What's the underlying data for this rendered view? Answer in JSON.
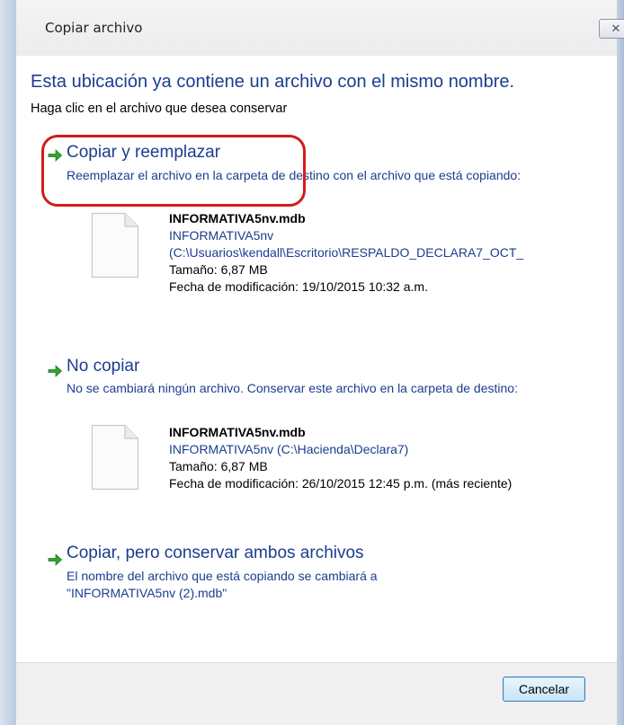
{
  "window": {
    "title": "Copiar archivo",
    "close_glyph": "✕"
  },
  "dialog": {
    "heading": "Esta ubicación ya contiene un archivo con el mismo nombre.",
    "instruction": "Haga clic en el archivo que desea conservar"
  },
  "options": [
    {
      "title": "Copiar y reemplazar",
      "description": "Reemplazar el archivo en la carpeta de destino con el archivo que está copiando:",
      "file": {
        "name": "INFORMATIVA5nv.mdb",
        "path_lines": [
          "INFORMATIVA5nv",
          "(C:\\Usuarios\\kendall\\Escritorio\\RESPALDO_DECLARA7_OCT_"
        ],
        "size": "Tamaño: 6,87 MB",
        "modified": "Fecha de modificación: 19/10/2015 10:32 a.m."
      }
    },
    {
      "title": "No copiar",
      "description": "No se cambiará ningún archivo. Conservar este archivo en la carpeta de destino:",
      "file": {
        "name": "INFORMATIVA5nv.mdb",
        "path_lines": [
          "INFORMATIVA5nv (C:\\Hacienda\\Declara7)"
        ],
        "size": "Tamaño: 6,87 MB",
        "modified": "Fecha de modificación: 26/10/2015 12:45 p.m. (más reciente)"
      }
    },
    {
      "title": "Copiar, pero conservar ambos archivos",
      "description_lines": [
        "El nombre del archivo que está copiando se cambiará a",
        "\"INFORMATIVA5nv (2).mdb\""
      ]
    }
  ],
  "footer": {
    "cancel_label": "Cancelar"
  },
  "icons": {
    "arrow": "green-arrow-icon",
    "file": "document-icon",
    "close": "close-icon"
  },
  "colors": {
    "link_blue": "#1b3d8f",
    "arrow_green": "#2ea52e",
    "highlight_red": "#d31c1c"
  }
}
